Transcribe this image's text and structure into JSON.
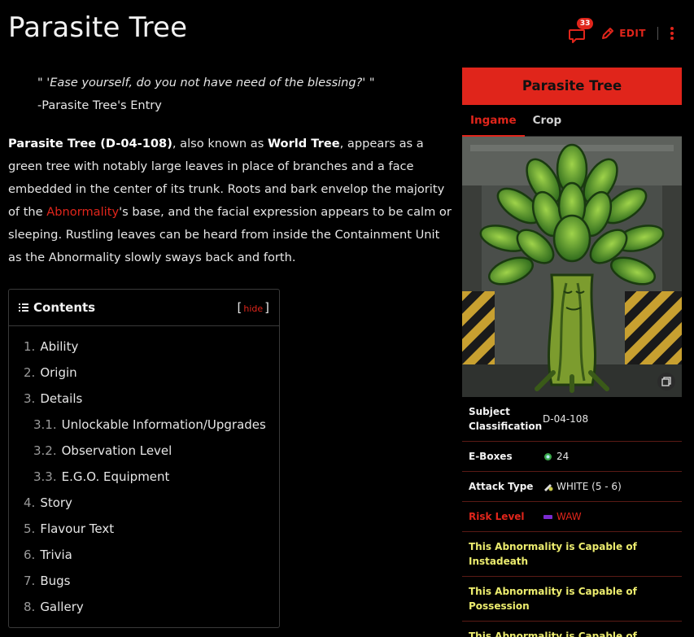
{
  "page": {
    "title": "Parasite Tree",
    "comment_count": "33",
    "edit_label": "EDIT"
  },
  "quote": {
    "text": "\" 'Ease yourself, do you not have need of the blessing?' \"",
    "source": "-Parasite Tree's Entry"
  },
  "intro": {
    "name_code": "Parasite Tree (D-04-108)",
    "t1": ", also known as ",
    "alias": "World Tree",
    "t2": ", appears as a green tree with notably large leaves in place of branches and a face embedded in the center of its trunk. Roots and bark envelop the majority of the ",
    "link": "Abnormality",
    "t3": "'s base, and the facial expression appears to be calm or sleeping. Rustling leaves can be heard from inside the Containment Unit as the Abnormality slowly sways back and forth."
  },
  "toc": {
    "title": "Contents",
    "hide_label": "hide",
    "items": [
      {
        "num": "1.",
        "label": "Ability"
      },
      {
        "num": "2.",
        "label": "Origin"
      },
      {
        "num": "3.",
        "label": "Details"
      },
      {
        "num": "3.1.",
        "label": "Unlockable Information/Upgrades"
      },
      {
        "num": "3.2.",
        "label": "Observation Level"
      },
      {
        "num": "3.3.",
        "label": "E.G.O. Equipment"
      },
      {
        "num": "4.",
        "label": "Story"
      },
      {
        "num": "5.",
        "label": "Flavour Text"
      },
      {
        "num": "6.",
        "label": "Trivia"
      },
      {
        "num": "7.",
        "label": "Bugs"
      },
      {
        "num": "8.",
        "label": "Gallery"
      }
    ]
  },
  "infobox": {
    "title": "Parasite Tree",
    "tabs": [
      "Ingame",
      "Crop"
    ],
    "rows": [
      {
        "label": "Subject Classification",
        "value": "D-04-108"
      },
      {
        "label": "E-Boxes",
        "value": "24"
      },
      {
        "label": "Attack Type",
        "value": "WHITE (5 - 6)"
      },
      {
        "label": "Risk Level",
        "value": "WAW"
      }
    ],
    "notes": [
      "This Abnormality is Capable of Instadeath",
      "This Abnormality is Capable of Possession",
      "This Abnormality is Capable of Employee Alteration"
    ]
  },
  "colors": {
    "accent": "#e0251b",
    "note_text": "#ecec6e",
    "background": "#000000"
  }
}
